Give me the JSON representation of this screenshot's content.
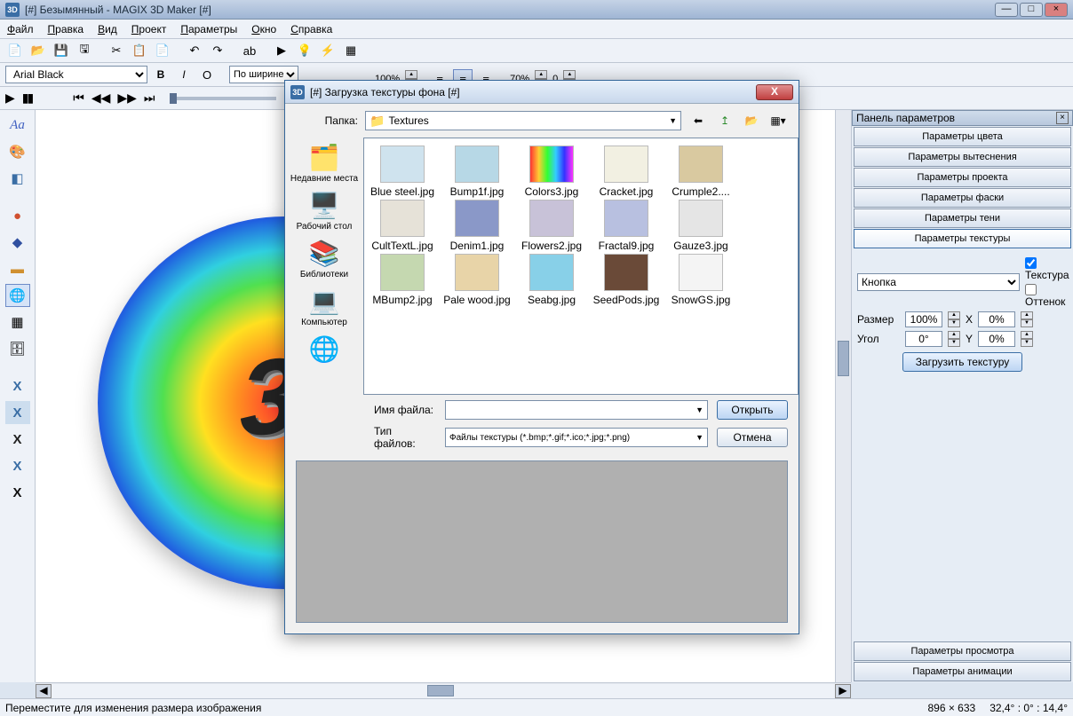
{
  "window": {
    "title": "[#] Безымянный - MAGIX 3D Maker [#]"
  },
  "menu": [
    "Файл",
    "Правка",
    "Вид",
    "Проект",
    "Параметры",
    "Окно",
    "Справка"
  ],
  "font_selector": "Arial Black",
  "align_selector": "По ширине",
  "zoom1": "100%",
  "zoom2": "70%",
  "zoom3": "0",
  "params_panel": {
    "title": "Панель параметров",
    "buttons": [
      "Параметры цвета",
      "Параметры вытеснения",
      "Параметры проекта",
      "Параметры фаски",
      "Параметры тени",
      "Параметры текстуры"
    ],
    "active_index": 5,
    "face_selector": "Кнопка",
    "cb_texture": "Текстура",
    "cb_tint": "Оттенок",
    "size_label": "Размер",
    "size_x": "100%",
    "size_y": "0%",
    "angle_label": "Угол",
    "angle_x": "0°",
    "angle_y": "0%",
    "x_label": "X",
    "y_label": "Y",
    "load_tex": "Загрузить текстуру",
    "bottom_buttons": [
      "Параметры просмотра",
      "Параметры анимации"
    ]
  },
  "dialog": {
    "title": "[#] Загрузка текстуры фона [#]",
    "folder_label": "Папка:",
    "folder_value": "Textures",
    "places": [
      {
        "icon": "🗂️",
        "label": "Недавние места"
      },
      {
        "icon": "🖥️",
        "label": "Рабочий стол"
      },
      {
        "icon": "📚",
        "label": "Библиотеки"
      },
      {
        "icon": "💻",
        "label": "Компьютер"
      },
      {
        "icon": "🌐",
        "label": ""
      }
    ],
    "files": [
      {
        "name": "Blue steel.jpg",
        "bg": "#cfe3ee"
      },
      {
        "name": "Bump1f.jpg",
        "bg": "#b7d8e6"
      },
      {
        "name": "Colors3.jpg",
        "bg": "linear-gradient(90deg,#f33,#fc3,#3f3,#3cf,#33f,#f3f)"
      },
      {
        "name": "Cracket.jpg",
        "bg": "#f2f0e2"
      },
      {
        "name": "Crumple2....",
        "bg": "#d9c9a0"
      },
      {
        "name": "CultTextL.jpg",
        "bg": "#e6e2d8"
      },
      {
        "name": "Denim1.jpg",
        "bg": "#8a98c8"
      },
      {
        "name": "Flowers2.jpg",
        "bg": "#c8c2d8"
      },
      {
        "name": "Fractal9.jpg",
        "bg": "#b8c0e0"
      },
      {
        "name": "Gauze3.jpg",
        "bg": "#e5e5e5"
      },
      {
        "name": "MBump2.jpg",
        "bg": "#c5d8b0"
      },
      {
        "name": "Pale wood.jpg",
        "bg": "#e8d4a8"
      },
      {
        "name": "Seabg.jpg",
        "bg": "#88d0e8"
      },
      {
        "name": "SeedPods.jpg",
        "bg": "#6a4a38"
      },
      {
        "name": "SnowGS.jpg",
        "bg": "#f4f4f4"
      }
    ],
    "filename_label": "Имя файла:",
    "filename_value": "",
    "filetype_label": "Тип файлов:",
    "filetype_value": "Файлы текстуры (*.bmp;*.gif;*.ico;*.jpg;*.png)",
    "open_btn": "Открыть",
    "cancel_btn": "Отмена"
  },
  "status": {
    "hint": "Переместите для изменения размера изображения",
    "dims": "896 × 633",
    "angles": "32,4° : 0° : 14,4°"
  },
  "canvas_text": "3D"
}
